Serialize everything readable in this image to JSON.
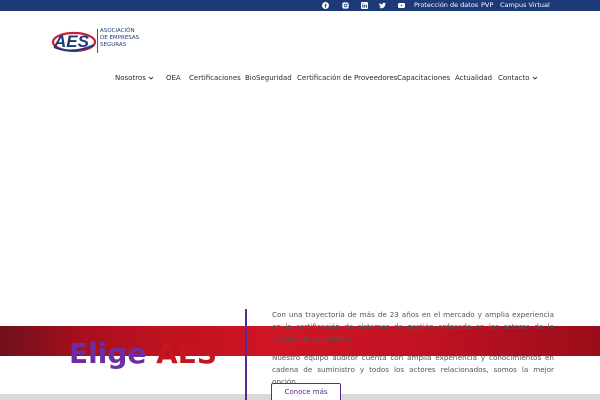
{
  "topbar": {
    "icons": [
      "facebook-icon",
      "instagram-icon",
      "linkedin-icon",
      "twitter-icon",
      "youtube-icon"
    ],
    "links": [
      "Protección de datos",
      "PVP",
      "Campus Virtual"
    ],
    "bg_color": "#1d3a78"
  },
  "logo": {
    "mark": "AES",
    "line1": "ASOCIACIÓN",
    "line2": "DE EMPRESAS",
    "line3": "SEGURAS"
  },
  "nav": {
    "items": [
      "Nosotros",
      "OEA",
      "Certificaciones",
      "BioSeguridad",
      "Certificación de Proveedores",
      "Capacitaciones",
      "Actualidad",
      "Contacto"
    ]
  },
  "hero": {
    "title_part1": "Elige",
    "title_part2": "AES",
    "paragraph1": "Con una trayectoria de más de 23 años en el mercado y amplia experiencia en la certificación de sistemas de gestión enfocada en los actores de la cadena de suministro.",
    "paragraph2": "Nuestro equipo auditor cuenta con amplia experiencia y conocimientos en cadena de suministro y todos los actores relacionados, somos la mejor opción.",
    "button_label": "Conoce más",
    "accent_purple": "#5a2a8c",
    "accent_red": "#c7151f"
  }
}
